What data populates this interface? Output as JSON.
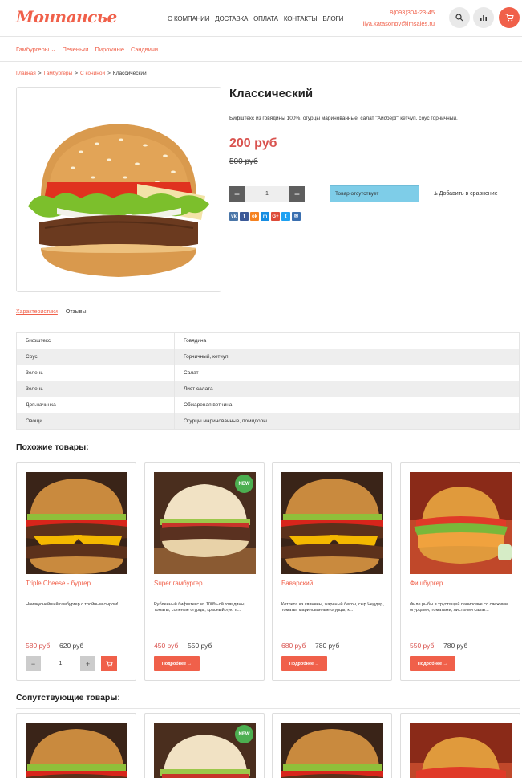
{
  "brand": {
    "logo": "Монпансье",
    "accent": "#f0604a"
  },
  "header": {
    "nav": [
      "О КОМПАНИИ",
      "ДОСТАВКА",
      "ОПЛАТА",
      "КОНТАКТЫ",
      "БЛОГИ"
    ],
    "phone": "8(093)304-23-45",
    "email": "ilya.katasonov@imsales.ru",
    "icons": [
      "search-icon",
      "compare-icon",
      "cart-icon"
    ]
  },
  "categories": [
    "Гамбургеры ⌄",
    "Печеньки",
    "Пирожные",
    "Сэндвичи"
  ],
  "breadcrumb": {
    "home": "Главная",
    "cat": "Гамбургеры",
    "sub": "С кониной",
    "current": "Классический",
    "sep": ">"
  },
  "product": {
    "title": "Классический",
    "description": "Бифштекс из говядины 100%, огурцы маринованные, салат \"Айсберг\" кетчуп, соус горчичный.",
    "price": "200 руб",
    "old_price": "500 руб",
    "qty": "1",
    "qty_minus": "−",
    "qty_plus": "+",
    "stock_status": "Товар отсутствует",
    "compare_label": "Добавить в сравнение",
    "social": [
      {
        "label": "vk",
        "color": "#4a76a8"
      },
      {
        "label": "f",
        "color": "#3b5998"
      },
      {
        "label": "ok",
        "color": "#f58220"
      },
      {
        "label": "m",
        "color": "#168de2"
      },
      {
        "label": "G+",
        "color": "#dd4b39"
      },
      {
        "label": "t",
        "color": "#1da1f2"
      },
      {
        "label": "✉",
        "color": "#3a6fb0"
      }
    ]
  },
  "tabs": [
    "Характеристики",
    "Отзывы"
  ],
  "specs": [
    [
      "Бифштекс",
      "Говядина"
    ],
    [
      "Соус",
      "Горчичный, кетчуп"
    ],
    [
      "Зелень",
      "Салат"
    ],
    [
      "Зелень",
      "Лист салата"
    ],
    [
      "Доп.начинка",
      "Обжареная ветчина"
    ],
    [
      "Овощи",
      "Огурцы маринованные, помидоры"
    ]
  ],
  "similar_title": "Похожие товары:",
  "related_title": "Сопутствующие товары:",
  "similar": [
    {
      "name": "Triple Cheese - бургер",
      "desc": "Наивкуснейший гамбургер с тройным сыром!",
      "price": "580 руб",
      "old": "620 руб",
      "qty": "1"
    },
    {
      "name": "Super гамбургер",
      "desc": "Рубленный бифштекс из 100%-ой говядины, томаты, соленые огурцы, красный лук, п...",
      "price": "450 руб",
      "old": "550 руб",
      "more": "Подробнее →",
      "badge": "NEW"
    },
    {
      "name": "Баварский",
      "desc": "Котлета из свинины, жареный бекон, сыр Чеддер, томаты, маринованные огурцы, к...",
      "price": "680 руб",
      "old": "780 руб",
      "more": "Подробнее →"
    },
    {
      "name": "Фишбургер",
      "desc": "Филе рыбы в хрустящей панировке со свежими огурцами, томатами, листьями салат...",
      "price": "550 руб",
      "old": "780 руб",
      "more": "Подробнее →"
    }
  ],
  "related_badge": "NEW"
}
